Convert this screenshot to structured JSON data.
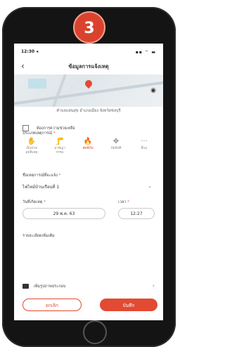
{
  "badge": "3",
  "status": {
    "time": "12:30 ◂",
    "icons": "▪▪ ⌔ ▬"
  },
  "header": {
    "title": "ข้อมูลการแจ้งเหตุ",
    "back_icon": "chevron-left-icon"
  },
  "map": {
    "address": "ตำบลแสนสุข อำเภอเมือง จังหวัดชลบุรี",
    "view_icon": "eye-icon"
  },
  "anonymous": {
    "label": "ต้องการความช่วยเหลือ"
  },
  "category_section": {
    "label": "ประเภทเหตุการณ์",
    "items": [
      {
        "label": "เจ็บป่วย\nอุบัติเหตุ",
        "icon": "✋"
      },
      {
        "label": "อาชญา\nกรรม",
        "icon": "🦵"
      },
      {
        "label": "อัคคีภัย",
        "icon": "🔥",
        "active": true
      },
      {
        "label": "ภัยพิบัติ",
        "icon": "✥"
      },
      {
        "label": "อื่นๆ",
        "icon": "···"
      }
    ]
  },
  "type_section": {
    "label": "ชื่อเหตุการณ์ที่จะแจ้ง",
    "value": "ไฟไหม้บ้านเรือนที่ 1"
  },
  "datetime_section": {
    "date_label": "วันที่เกิดเหตุ",
    "time_label": "เวลา",
    "date_value": "29 พ.ค. 63",
    "time_value": "12:27"
  },
  "details_section": {
    "label": "รายละเอียดเพิ่มเติม"
  },
  "attach": {
    "label": "เพิ่มรูปภาพประกอบ",
    "icon": "camera-icon"
  },
  "buttons": {
    "cancel": "ยกเลิก",
    "save": "บันทึก"
  },
  "colors": {
    "accent": "#e24a33"
  }
}
